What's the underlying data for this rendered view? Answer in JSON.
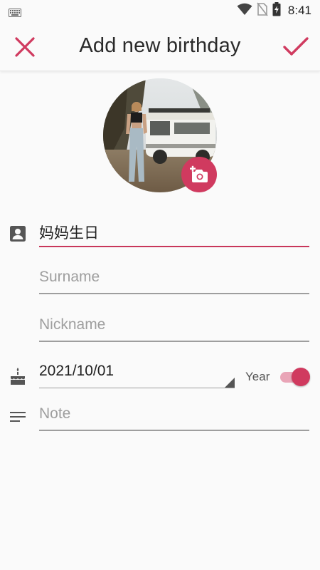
{
  "status_bar": {
    "time": "8:41",
    "icons": [
      "keyboard-icon",
      "wifi-icon",
      "no-sim-icon",
      "battery-charging-icon"
    ]
  },
  "appbar": {
    "title": "Add new birthday",
    "close_icon": "close-icon",
    "done_icon": "check-icon"
  },
  "avatar": {
    "add_photo_icon": "add-photo-icon"
  },
  "form": {
    "name_value": "妈妈生日",
    "surname_placeholder": "Surname",
    "nickname_placeholder": "Nickname",
    "date_value": "2021/10/01",
    "year_label": "Year",
    "year_toggle_on": true,
    "note_placeholder": "Note"
  },
  "colors": {
    "accent": "#d03a5f",
    "accent_light": "#e9a5b7",
    "divider": "#9e9e9e",
    "background": "#fafafa"
  }
}
